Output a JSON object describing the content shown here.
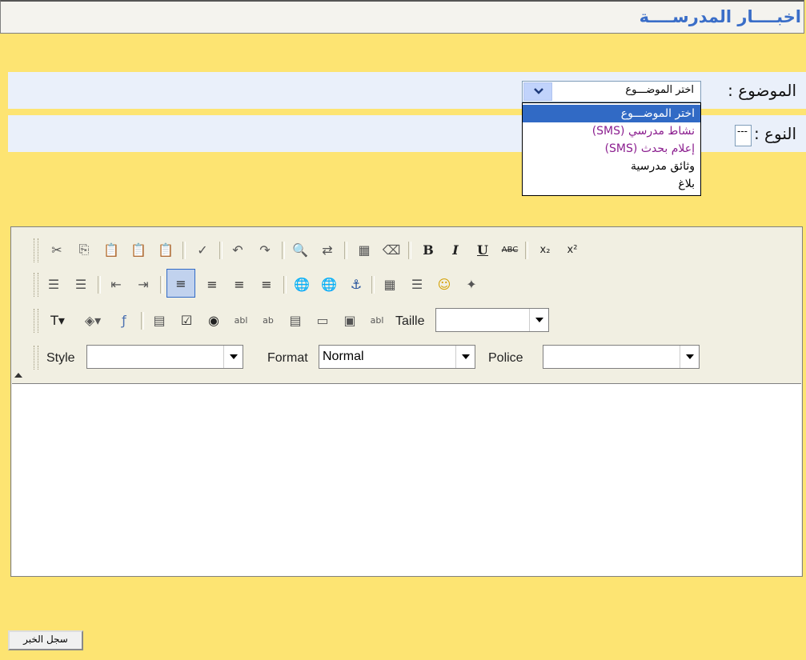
{
  "header": {
    "title": "اخبــــار المدرســــة"
  },
  "form": {
    "subject_label": "الموضوع :",
    "type_label": "النوع :",
    "subject_select": {
      "value": "اختر الموضـــوع",
      "options": [
        {
          "label": "اختر الموضـــوع",
          "selected": true,
          "color": "#ffffff"
        },
        {
          "label": "نشاط مدرسي (SMS)",
          "selected": false,
          "color": "#8b1e8f"
        },
        {
          "label": "إعلام بحدث (SMS)",
          "selected": false,
          "color": "#8b1e8f"
        },
        {
          "label": "وثائق مدرسية",
          "selected": false,
          "color": "#000000"
        },
        {
          "label": "بلاغ",
          "selected": false,
          "color": "#000000"
        }
      ]
    },
    "type_select": {
      "value": "---"
    }
  },
  "editor": {
    "toolbar": {
      "row1_icons": [
        "cut-icon",
        "copy-icon",
        "paste-icon",
        "paste-text-icon",
        "paste-word-icon",
        "spellcheck-icon",
        "undo-icon",
        "redo-icon",
        "find-icon",
        "replace-icon",
        "select-all-icon",
        "remove-format-icon",
        "bold-icon",
        "italic-icon",
        "underline-icon",
        "strikethrough-icon",
        "subscript-icon",
        "superscript-icon"
      ],
      "row2_icons": [
        "ordered-list-icon",
        "unordered-list-icon",
        "outdent-icon",
        "indent-icon",
        "align-left-icon",
        "align-center-icon",
        "align-right-icon",
        "justify-icon",
        "link-icon",
        "unlink-icon",
        "anchor-icon",
        "table-icon",
        "horizontal-rule-icon",
        "smiley-icon",
        "special-char-icon"
      ],
      "row3_icons": [
        "text-color-icon",
        "bg-color-icon",
        "flash-icon",
        "form-icon",
        "checkbox-icon",
        "radio-icon",
        "textfield-icon",
        "textarea-icon",
        "select-field-icon",
        "button-field-icon",
        "image-button-icon",
        "hidden-field-icon"
      ],
      "size_label": "Taille",
      "size_value": "",
      "style_label": "Style",
      "style_value": "",
      "format_label": "Format",
      "format_value": "Normal",
      "font_label": "Police",
      "font_value": "",
      "bold_glyph": "B",
      "italic_glyph": "I",
      "underline_glyph": "U",
      "strike_glyph": "ABC"
    },
    "content": ""
  },
  "actions": {
    "save_label": "سجل الخبر"
  },
  "colors": {
    "background": "#fde472",
    "title": "#3a6ec8",
    "row": "#eaf0fa",
    "selected": "#316ac5",
    "purple": "#8b1e8f"
  }
}
